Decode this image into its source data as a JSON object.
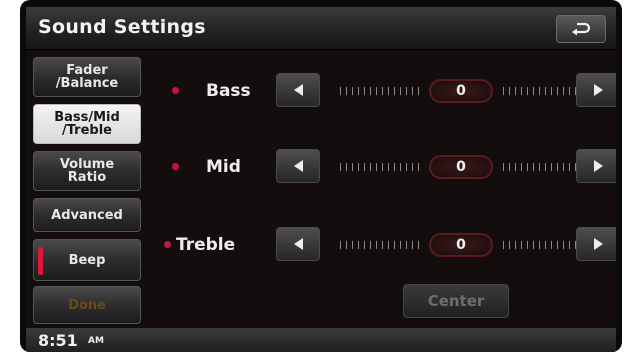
{
  "header": {
    "title": "Sound Settings",
    "back_icon": "back-arrow-icon"
  },
  "sidebar": {
    "items": [
      {
        "label": "Fader\n/Balance",
        "active": false
      },
      {
        "label": "Bass/Mid\n/Treble",
        "active": true
      },
      {
        "label": "Volume\nRatio",
        "active": false
      },
      {
        "label": "Advanced",
        "active": false
      },
      {
        "label": "Beep",
        "active": false,
        "indicator_color": "#e0153a"
      },
      {
        "label": "Done",
        "active": false,
        "disabled": true
      }
    ]
  },
  "controls": [
    {
      "label": "Bass",
      "value": "0"
    },
    {
      "label": "Mid",
      "value": "0"
    },
    {
      "label": "Treble",
      "value": "0"
    }
  ],
  "center_button": {
    "label": "Center",
    "disabled": true
  },
  "status": {
    "time": "8:51",
    "ampm": "AM"
  },
  "colors": {
    "accent_red": "#c3163a",
    "background": "#140d0d"
  }
}
